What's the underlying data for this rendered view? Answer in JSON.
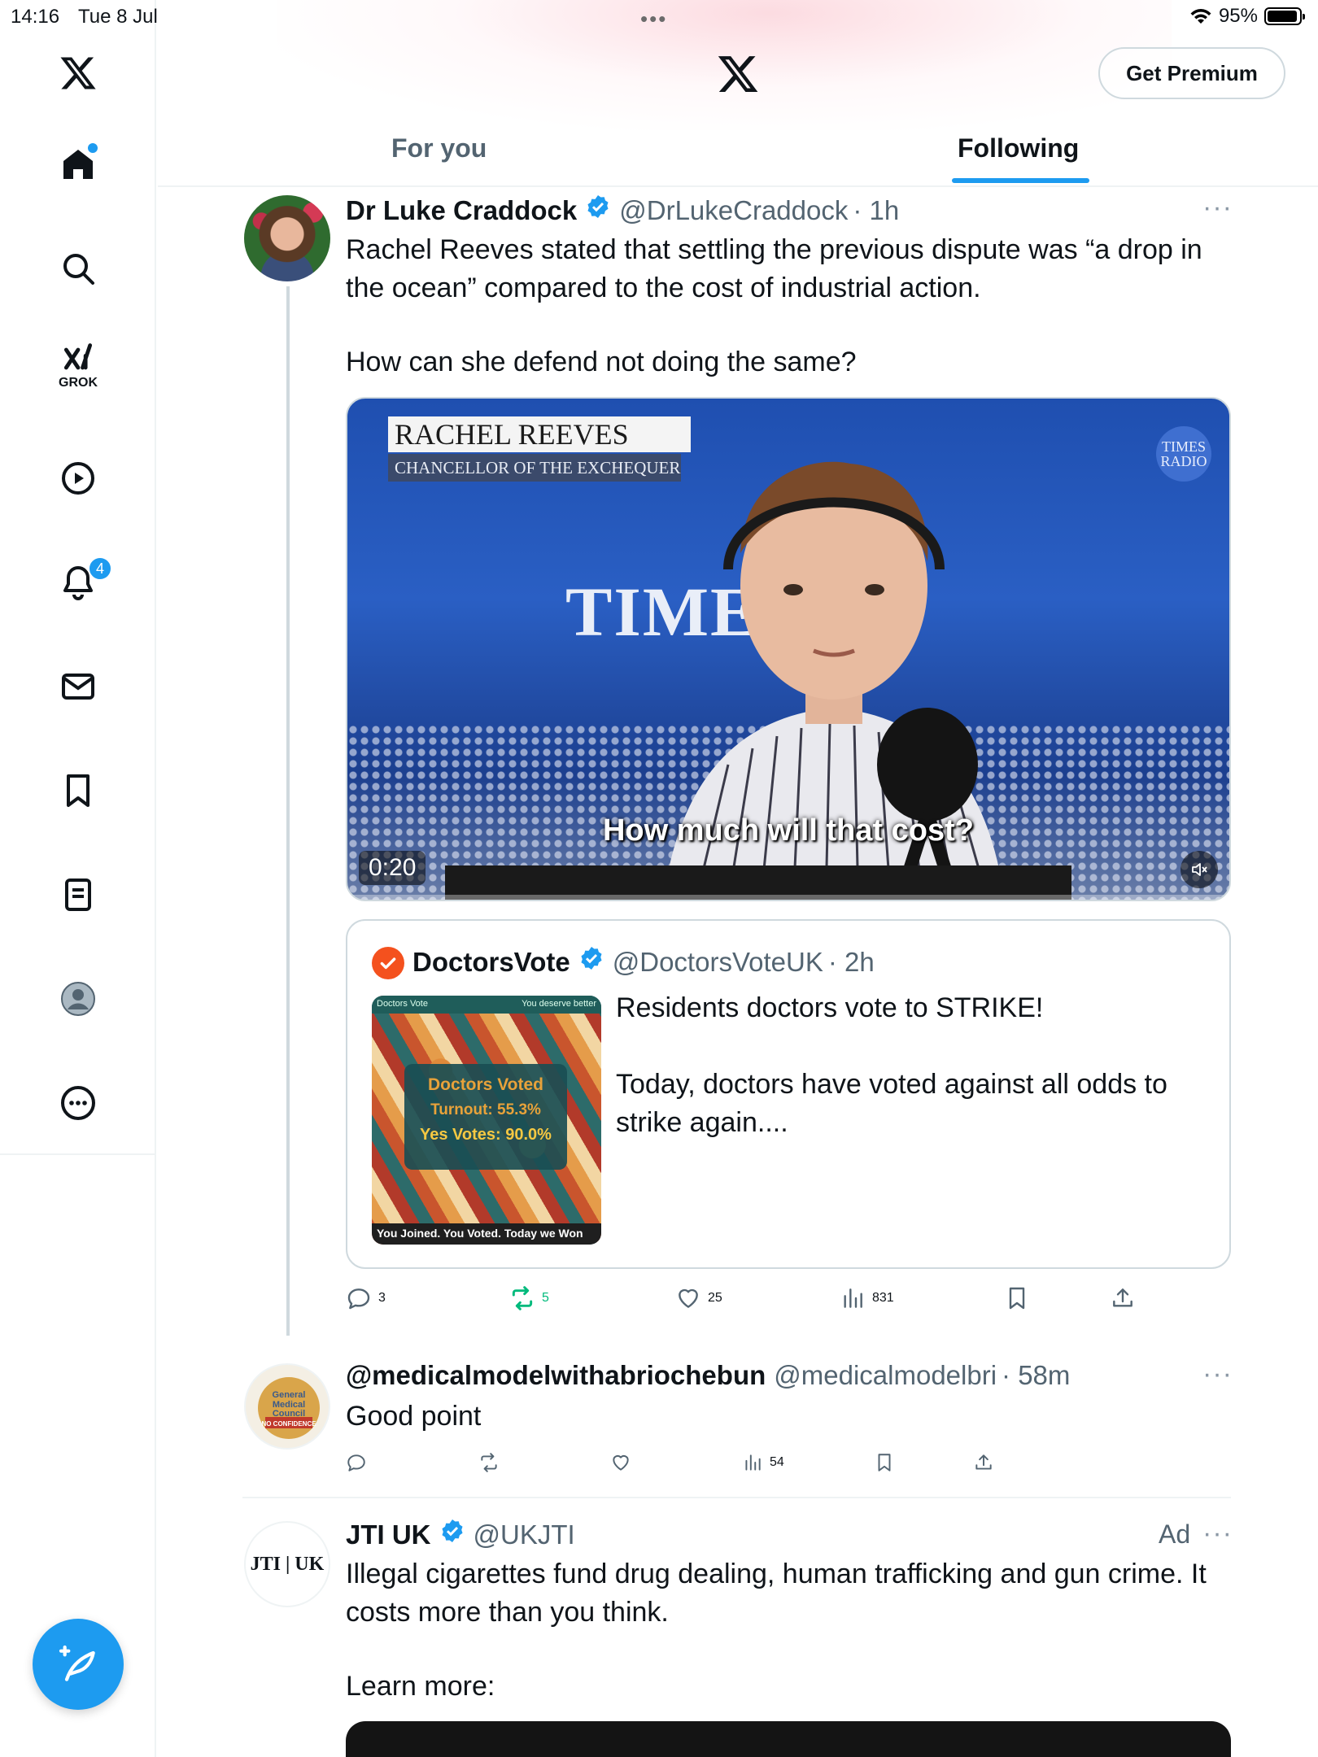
{
  "status_bar": {
    "time": "14:16",
    "date": "Tue 8 Jul",
    "battery": "95%"
  },
  "sidebar": {
    "grok_label": "GROK",
    "notifications_badge": "4"
  },
  "header": {
    "premium_label": "Get Premium",
    "tabs": [
      {
        "label": "For you",
        "active": false
      },
      {
        "label": "Following",
        "active": true
      }
    ]
  },
  "tweets": [
    {
      "name": "Dr Luke Craddock",
      "handle": "@DrLukeCraddock",
      "time": "· 1h",
      "text1": "Rachel Reeves stated that settling the previous dispute was “a drop in the ocean” compared to the cost of industrial action.",
      "text2": "How can she defend not doing the same?",
      "video": {
        "lower_third_name": "RACHEL REEVES",
        "lower_third_role": "CHANCELLOR OF THE EXCHEQUER",
        "logo": "TIMES RADIO",
        "backdrop": "TIME",
        "caption": "How much will that cost?",
        "duration": "0:20"
      },
      "quote": {
        "name": "DoctorsVote",
        "handle": "@DoctorsVoteUK",
        "time": "· 2h",
        "text1": "Residents doctors vote to STRIKE!",
        "text2": "Today, doctors have voted against all odds to strike again....",
        "image": {
          "top_left": "Doctors Vote",
          "top_right": "You deserve better",
          "line1": "Doctors Voted",
          "line2": "Turnout: 55.3%",
          "line3": "Yes Votes: 90.0%",
          "bottom": "You Joined. You Voted. Today we Won"
        }
      },
      "stats": {
        "replies": "3",
        "reposts": "5",
        "likes": "25",
        "views": "831"
      }
    },
    {
      "name": "@medicalmodelwithabriochebun",
      "handle": "@medicalmodelbri",
      "time": "· 58m",
      "text": "Good point",
      "avatar_text": "General Medical Council NO CONFIDENCE",
      "stats": {
        "views": "54"
      }
    },
    {
      "name": "JTI UK",
      "handle": "@UKJTI",
      "ad_label": "Ad",
      "avatar_text": "JTI | UK",
      "text1": "Illegal cigarettes fund drug dealing, human trafficking  and gun crime. It costs more than you think.",
      "text2": "Learn more:"
    }
  ],
  "colors": {
    "accent": "#1d9bf0",
    "repost_green": "#00ba7c",
    "secondary_text": "#536471",
    "border": "#cfd9de"
  }
}
